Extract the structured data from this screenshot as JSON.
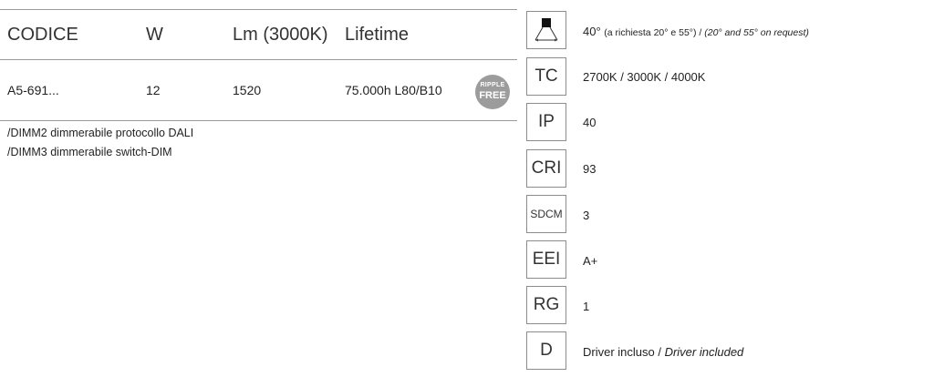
{
  "table": {
    "headers": {
      "code": "CODICE",
      "w": "W",
      "lm": "Lm (3000K)",
      "lifetime": "Lifetime"
    },
    "row": {
      "code": "A5-691...",
      "w": "12",
      "lm": "1520",
      "lifetime": "75.000h L80/B10"
    },
    "badge": {
      "top": "RIPPLE",
      "bottom": "FREE"
    },
    "notes": [
      "/DIMM2  dimmerabile protocollo DALI",
      "/DIMM3  dimmerabile switch-DIM"
    ]
  },
  "specs": {
    "beam": {
      "icon": "beam-angle-icon",
      "value": "40°",
      "paren": "(a richiesta 20° e 55°) / ",
      "italic": "(20° and 55° on request)"
    },
    "tc": {
      "label": "TC",
      "value": "2700K / 3000K / 4000K"
    },
    "ip": {
      "label": "IP",
      "value": "40"
    },
    "cri": {
      "label": "CRI",
      "value": "93"
    },
    "sdcm": {
      "label": "SDCM",
      "value": "3"
    },
    "eei": {
      "label": "EEI",
      "value": "A+"
    },
    "rg": {
      "label": "RG",
      "value": "1"
    },
    "d": {
      "label": "D",
      "value": "Driver incluso / ",
      "italic": "Driver included"
    }
  }
}
